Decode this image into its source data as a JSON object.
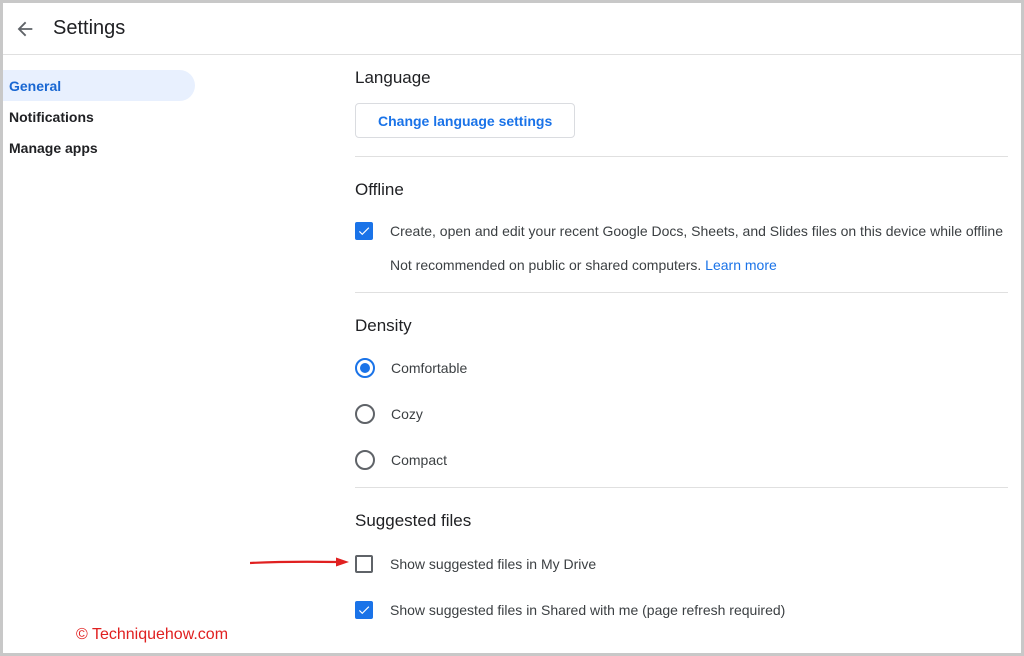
{
  "header": {
    "title": "Settings",
    "back_icon": "arrow-back-icon"
  },
  "sidebar": {
    "items": [
      {
        "label": "General",
        "active": true
      },
      {
        "label": "Notifications",
        "active": false
      },
      {
        "label": "Manage apps",
        "active": false
      }
    ]
  },
  "language": {
    "title": "Language",
    "button_label": "Change language settings"
  },
  "offline": {
    "title": "Offline",
    "checkbox_label": "Create, open and edit your recent Google Docs, Sheets, and Slides files on this device while offline",
    "checked": true,
    "note": "Not recommended on public or shared computers.",
    "learn_more": "Learn more"
  },
  "density": {
    "title": "Density",
    "options": [
      {
        "label": "Comfortable",
        "selected": true
      },
      {
        "label": "Cozy",
        "selected": false
      },
      {
        "label": "Compact",
        "selected": false
      }
    ]
  },
  "suggested": {
    "title": "Suggested files",
    "options": [
      {
        "label": "Show suggested files in My Drive",
        "checked": false
      },
      {
        "label": "Show suggested files in Shared with me (page refresh required)",
        "checked": true
      }
    ]
  },
  "watermark": "© Techniquehow.com",
  "colors": {
    "accent": "#1a73e8",
    "annotation_arrow": "#e02020",
    "active_nav_bg": "#e8f0fe"
  }
}
